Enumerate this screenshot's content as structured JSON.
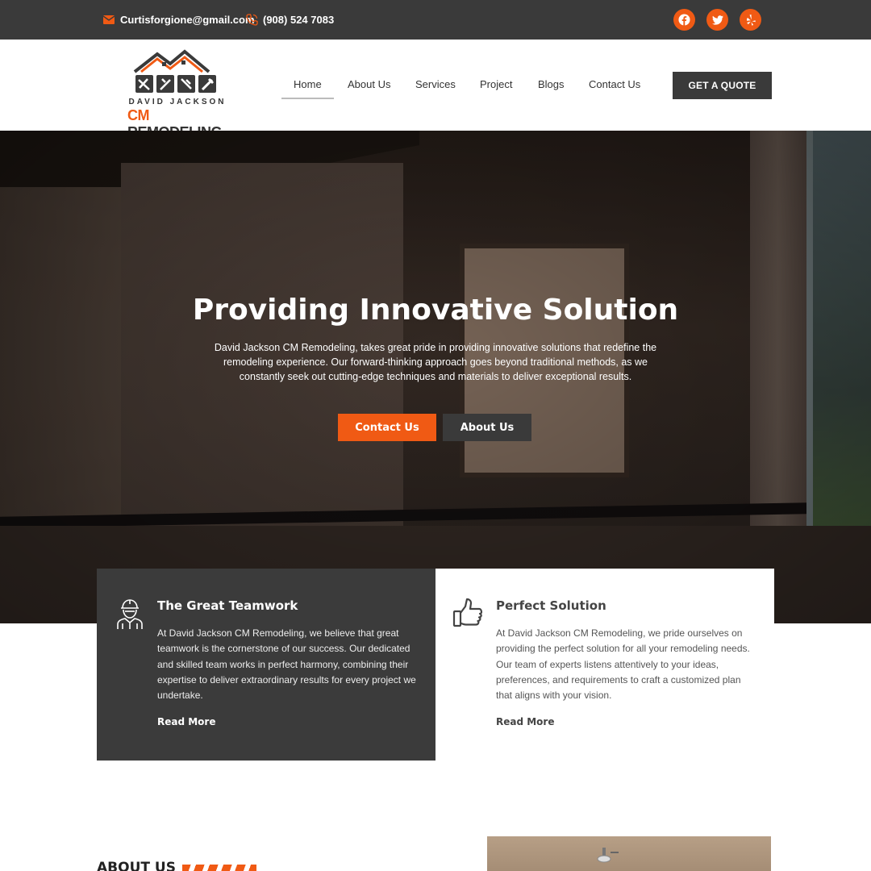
{
  "topbar": {
    "email": "Curtisforgione@gmail.com",
    "phone": "(908) 524 7083",
    "social": [
      {
        "name": "facebook",
        "icon": "facebook-icon"
      },
      {
        "name": "twitter",
        "icon": "twitter-icon"
      },
      {
        "name": "yelp",
        "icon": "yelp-icon"
      }
    ],
    "accent": "#f05a14",
    "background": "#3a3a3a"
  },
  "header": {
    "logo_line1": "DAVID JACKSON",
    "logo_cm": "CM",
    "logo_line2": " REMODELING",
    "nav": [
      "Home",
      "About Us",
      "Services",
      "Project",
      "Blogs",
      "Contact Us"
    ],
    "active_nav": "Home",
    "cta": "GET A QUOTE"
  },
  "hero": {
    "title": "Providing Innovative Solution",
    "text": "David Jackson CM Remodeling, takes great pride in providing innovative solutions that redefine the remodeling experience. Our forward-thinking approach goes beyond traditional methods, as we constantly seek out cutting-edge techniques and materials to deliver exceptional results.",
    "btn_primary": "Contact Us",
    "btn_secondary": "About Us"
  },
  "features": [
    {
      "icon": "worker-icon",
      "title": "The Great Teamwork",
      "text": "At David Jackson CM Remodeling, we believe that great teamwork is the cornerstone of our success. Our dedicated and skilled team works in perfect harmony, combining their expertise to deliver extraordinary results for every project we undertake.",
      "link": "Read More"
    },
    {
      "icon": "thumbs-up-icon",
      "title": "Perfect Solution",
      "text": "At David Jackson CM Remodeling, we pride ourselves on providing the perfect solution for all your remodeling needs. Our team of experts listens attentively to your ideas, preferences, and requirements to craft a customized plan that aligns with your vision.",
      "link": "Read More"
    }
  ],
  "about": {
    "title": "ABOUT US"
  }
}
